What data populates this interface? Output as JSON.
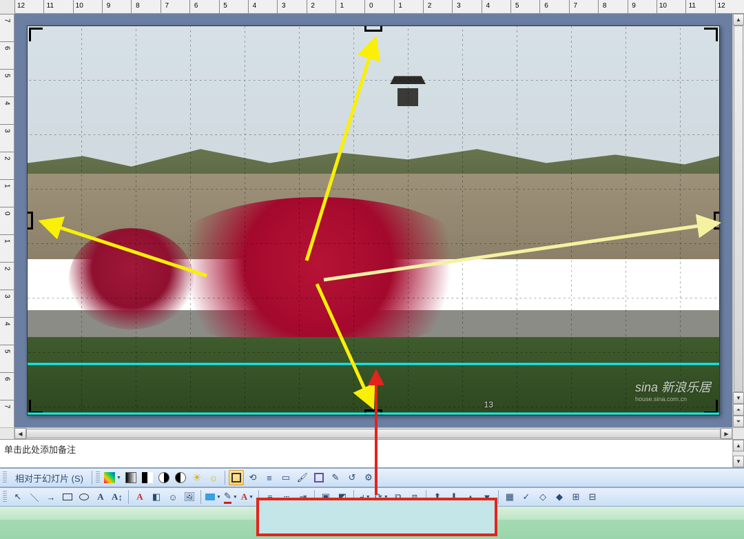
{
  "ruler": {
    "h": [
      "12",
      "11",
      "10",
      "9",
      "8",
      "7",
      "6",
      "5",
      "4",
      "3",
      "2",
      "1",
      "0",
      "1",
      "2",
      "3",
      "4",
      "5",
      "6",
      "7",
      "8",
      "9",
      "10",
      "11",
      "12"
    ],
    "v": [
      "7",
      "6",
      "5",
      "4",
      "3",
      "2",
      "1",
      "0",
      "1",
      "2",
      "3",
      "4",
      "5",
      "6",
      "7"
    ]
  },
  "slide": {
    "page_number": "13",
    "watermark_main": "sina 新浪乐居",
    "watermark_sub": "house.sina.com.cn"
  },
  "notes": {
    "placeholder": "单击此处添加备注"
  },
  "toolbar_picture": {
    "relative_label": "相对于幻灯片 (S)",
    "btns": {
      "color_menu": "▦",
      "grayscale": "grayscale",
      "bw": "bw",
      "more_contrast": "◐",
      "less_contrast": "◑",
      "more_bright": "☀",
      "less_bright": "☼",
      "crop": "✂",
      "rotate_left": "⟲",
      "line_style": "≡",
      "compress": "▭",
      "recolor": "🖌",
      "format": "⚙",
      "set_transparent": "✎",
      "reset": "↺"
    }
  },
  "toolbar_drawing": {
    "tools": {
      "select": "↖",
      "line": "＼",
      "arrow": "→",
      "rect": "▭",
      "ellipse": "◯",
      "textbox": "A▭",
      "vtext": "A↕",
      "wordart": "A",
      "diagram": "◧",
      "clipart": "☺",
      "picture": "🖼",
      "fill_color": "🪣",
      "line_color": "✎",
      "font_color": "A",
      "line_weight": "≡",
      "dash": "┄",
      "arrow_style": "⇥",
      "shadow": "▣",
      "3d": "◩",
      "align": "⫞",
      "rotate": "⟳",
      "group": "⧉",
      "ungroup": "⧈",
      "bring_front": "⬆",
      "send_back": "⬇",
      "grid": "▦",
      "snap": "✓",
      "more1": "◇",
      "more2": "◆",
      "more3": "▲",
      "more4": "▼"
    }
  },
  "colors": {
    "arrow_yellow": "#f9ef09",
    "arrow_yellow_light": "#f4f2a2",
    "guide_cyan": "#06f4f9",
    "callout_red": "#e2241d",
    "toolbar_active": "#f5b338"
  }
}
